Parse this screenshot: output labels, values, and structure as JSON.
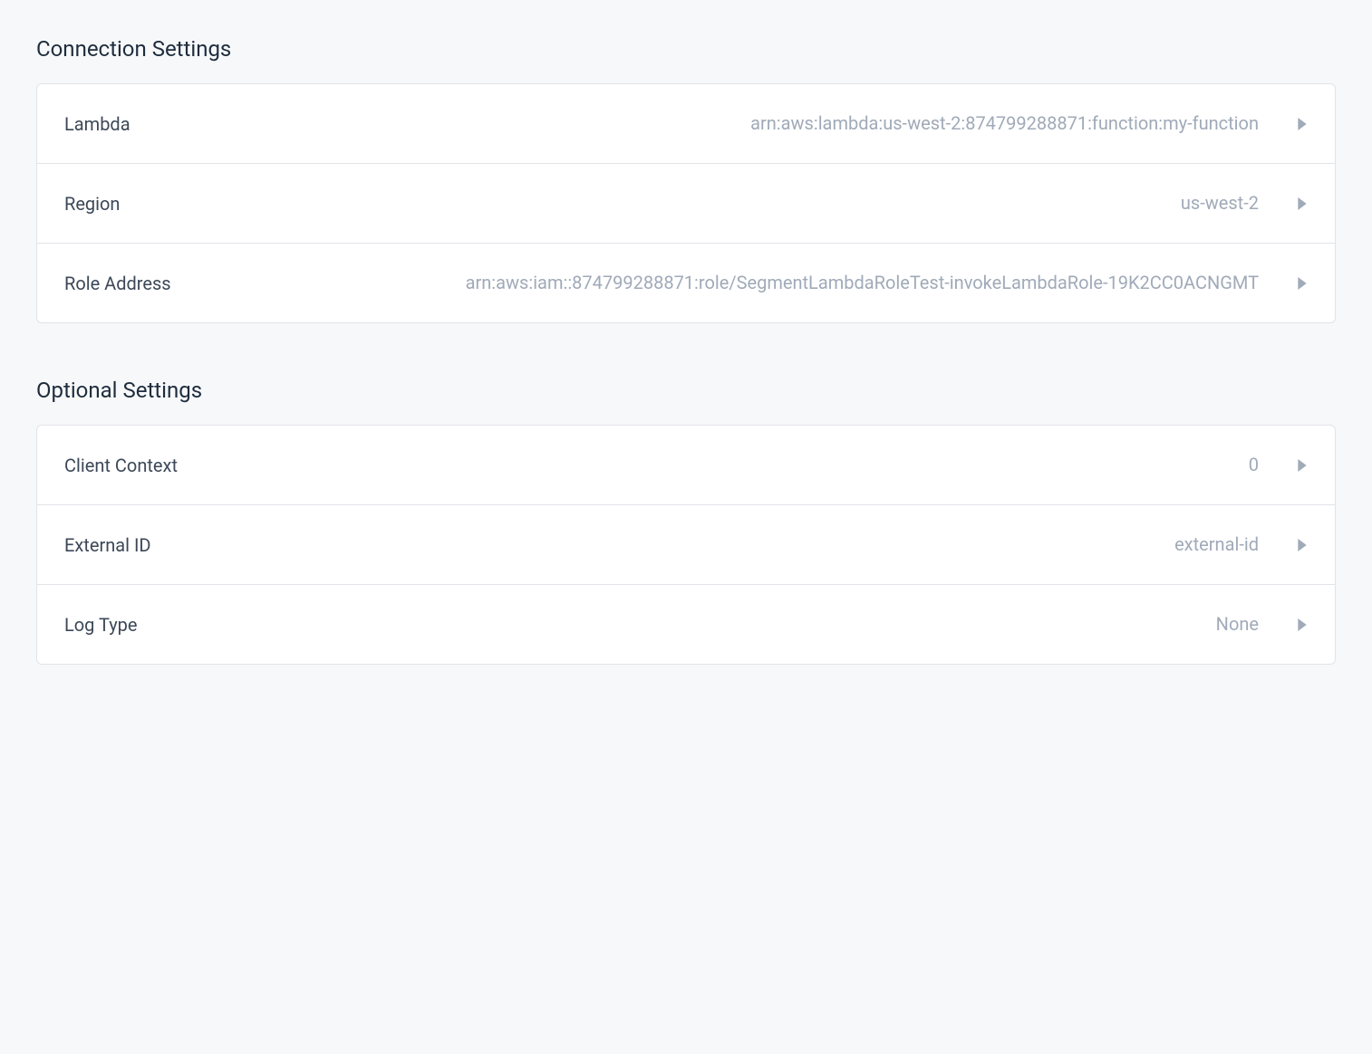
{
  "connection": {
    "title": "Connection Settings",
    "rows": {
      "lambda": {
        "label": "Lambda",
        "value": "arn:aws:lambda:us-west-2:874799288871:function:my-function"
      },
      "region": {
        "label": "Region",
        "value": "us-west-2"
      },
      "roleAddress": {
        "label": "Role Address",
        "value": "arn:aws:iam::874799288871:role/SegmentLambdaRoleTest-invokeLambdaRole-19K2CC0ACNGMT"
      }
    }
  },
  "optional": {
    "title": "Optional Settings",
    "rows": {
      "clientContext": {
        "label": "Client Context",
        "value": "0"
      },
      "externalId": {
        "label": "External ID",
        "value": "external-id"
      },
      "logType": {
        "label": "Log Type",
        "value": "None"
      }
    }
  }
}
